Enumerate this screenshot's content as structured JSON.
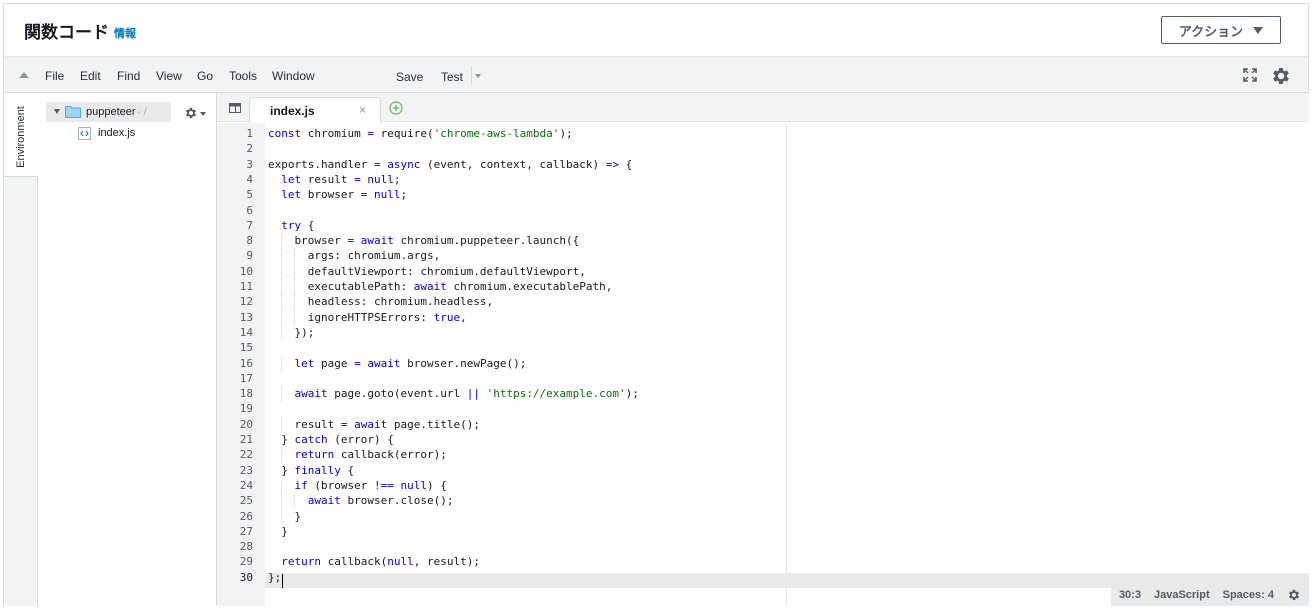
{
  "header": {
    "title": "関数コード",
    "info_link": "情報",
    "action_button": "アクション"
  },
  "menubar": {
    "items": [
      "File",
      "Edit",
      "Find",
      "View",
      "Go",
      "Tools",
      "Window"
    ],
    "save": "Save",
    "test": "Test"
  },
  "sidebar": {
    "environment_tab": "Environment",
    "root_folder": "puppeteer",
    "root_path": "- /",
    "files": [
      "index.js"
    ]
  },
  "editor": {
    "active_tab": "index.js",
    "tab_close": "×",
    "lines": [
      "const chromium = require('chrome-aws-lambda');",
      "",
      "exports.handler = async (event, context, callback) => {",
      "  let result = null;",
      "  let browser = null;",
      "",
      "  try {",
      "    browser = await chromium.puppeteer.launch({",
      "      args: chromium.args,",
      "      defaultViewport: chromium.defaultViewport,",
      "      executablePath: await chromium.executablePath,",
      "      headless: chromium.headless,",
      "      ignoreHTTPSErrors: true,",
      "    });",
      "",
      "    let page = await browser.newPage();",
      "",
      "    await page.goto(event.url || 'https://example.com');",
      "",
      "    result = await page.title();",
      "  } catch (error) {",
      "    return callback(error);",
      "  } finally {",
      "    if (browser !== null) {",
      "      await browser.close();",
      "    }",
      "  }",
      "",
      "  return callback(null, result);",
      "};"
    ],
    "active_line": 30
  },
  "status_bar": {
    "position": "30:3",
    "language": "JavaScript",
    "spaces": "Spaces: 4"
  },
  "colors": {
    "keyword": "#0000d6",
    "string": "#0b6f0b",
    "link": "#0073bb"
  }
}
